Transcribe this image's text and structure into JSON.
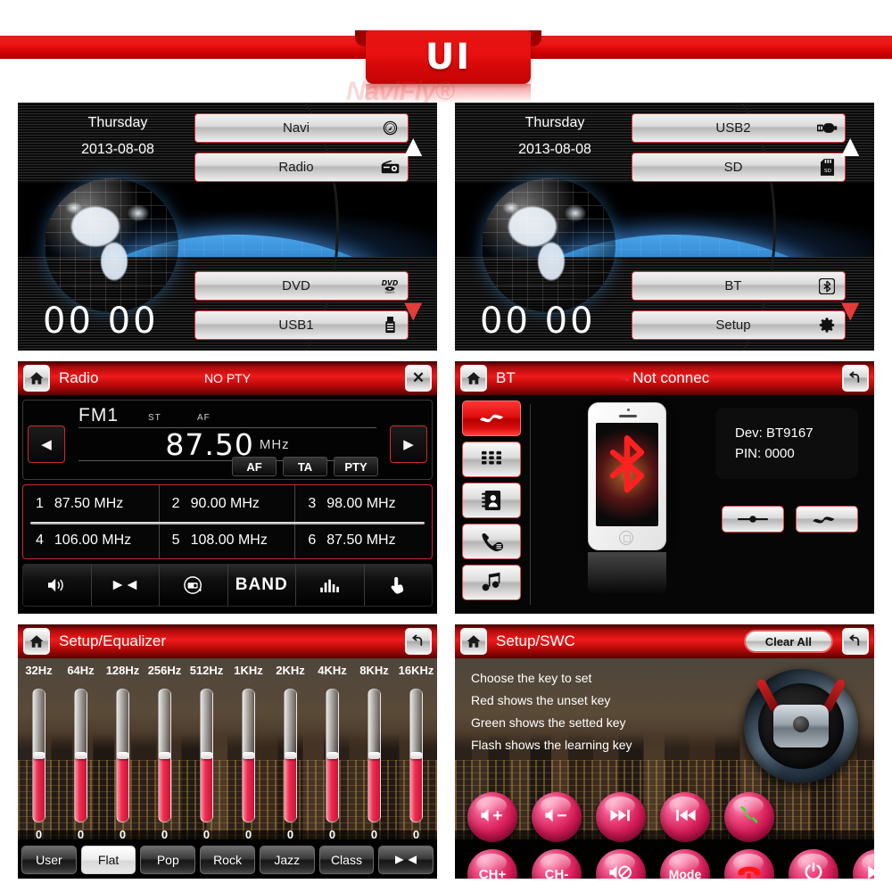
{
  "banner": {
    "title": "UI",
    "watermark": "NaviFly®"
  },
  "colors": {
    "accent_red": "#e01414",
    "panel_bg": "#000000",
    "button_silver": "#dcdcdc",
    "eq_fill": "#ef2d52",
    "swc_key": "#d41a55"
  },
  "home_left": {
    "day": "Thursday",
    "date": "2013-08-08",
    "clock": "00 00",
    "buttons": [
      {
        "label": "Navi",
        "icon": "compass-icon"
      },
      {
        "label": "Radio",
        "icon": "radio-icon"
      },
      {
        "label": "DVD",
        "icon": "dvd-video-icon"
      },
      {
        "label": "USB1",
        "icon": "usb-icon"
      }
    ],
    "page_up": "▲",
    "page_down": "▼"
  },
  "home_right": {
    "day": "Thursday",
    "date": "2013-08-08",
    "clock": "00 00",
    "buttons": [
      {
        "label": "USB2",
        "icon": "usb-stick-icon"
      },
      {
        "label": "SD",
        "icon": "sd-card-icon"
      },
      {
        "label": "BT",
        "icon": "bluetooth-icon"
      },
      {
        "label": "Setup",
        "icon": "gear-icon"
      }
    ],
    "page_up": "▲",
    "page_down": "▼"
  },
  "radio": {
    "title": "Radio",
    "pty_status": "NO PTY",
    "home_icon": "home-icon",
    "close_icon": "✕",
    "band": "FM1",
    "stereo_flag": "ST",
    "af_flag": "AF",
    "frequency": "87.50",
    "unit": "MHz",
    "prev_icon": "◀",
    "next_icon": "▶",
    "tags": [
      "AF",
      "TA",
      "PTY"
    ],
    "presets": [
      {
        "num": "1",
        "freq": "87.50 MHz"
      },
      {
        "num": "2",
        "freq": "90.00 MHz"
      },
      {
        "num": "3",
        "freq": "98.00 MHz"
      },
      {
        "num": "4",
        "freq": "106.00 MHz"
      },
      {
        "num": "5",
        "freq": "108.00 MHz"
      },
      {
        "num": "6",
        "freq": "87.50 MHz"
      }
    ],
    "tools": [
      {
        "name": "volume-icon",
        "glyph": "🔊"
      },
      {
        "name": "balance-icon",
        "glyph": "▶◀"
      },
      {
        "name": "autoscan-icon",
        "glyph": "⟳"
      },
      {
        "name": "band-label",
        "glyph": "BAND"
      },
      {
        "name": "equalizer-icon",
        "glyph": "ılıl"
      },
      {
        "name": "touch-icon",
        "glyph": "☚"
      }
    ]
  },
  "bt": {
    "title": "BT",
    "status": "Not connec",
    "home_icon": "home-icon",
    "back_icon": "↰",
    "side_buttons": [
      {
        "name": "bt-connect-icon",
        "glyph": "〰",
        "active": true
      },
      {
        "name": "bt-dialpad-icon",
        "glyph": "▦",
        "active": false
      },
      {
        "name": "bt-phonebook-icon",
        "glyph": "👤",
        "active": false
      },
      {
        "name": "bt-callog-icon",
        "glyph": "📞",
        "active": false
      },
      {
        "name": "bt-music-icon",
        "glyph": "♫",
        "active": false
      }
    ],
    "device_label": "Dev: BT9167",
    "pin_label": "PIN: 0000",
    "bluetooth_symbol": "ᚼ",
    "actions": [
      {
        "name": "bt-pair-button",
        "glyph": "—●—"
      },
      {
        "name": "bt-connect-button",
        "glyph": "〰"
      }
    ]
  },
  "equalizer": {
    "title": "Setup/Equalizer",
    "home_icon": "home-icon",
    "back_icon": "↰",
    "presets": [
      {
        "label": "User",
        "active": false
      },
      {
        "label": "Flat",
        "active": true
      },
      {
        "label": "Pop",
        "active": false
      },
      {
        "label": "Rock",
        "active": false
      },
      {
        "label": "Jazz",
        "active": false
      },
      {
        "label": "Class",
        "active": false
      }
    ],
    "balance_icon": "▶◀"
  },
  "chart_data": {
    "type": "bar",
    "title": "Setup/Equalizer",
    "categories": [
      "32Hz",
      "64Hz",
      "128Hz",
      "256Hz",
      "512Hz",
      "1KHz",
      "2KHz",
      "4KHz",
      "8KHz",
      "16KHz"
    ],
    "values": [
      0,
      0,
      0,
      0,
      0,
      0,
      0,
      0,
      0,
      0
    ],
    "value_labels": [
      "0",
      "0",
      "0",
      "0",
      "0",
      "0",
      "0",
      "0",
      "0",
      "0"
    ],
    "xlabel": "",
    "ylabel": "",
    "ylim": [
      -12,
      12
    ],
    "grid": false,
    "legend": "none",
    "orientation": "vertical-sliders"
  },
  "swc": {
    "title": "Setup/SWC",
    "home_icon": "home-icon",
    "back_icon": "↰",
    "clear_all": "Clear All",
    "instructions": [
      "Choose the key to set",
      "Red shows the unset key",
      "Green shows the setted key",
      "Flash shows the learning key"
    ],
    "wheel_icon": "steering-wheel-icon",
    "keys_row1": [
      {
        "name": "volume-up-key",
        "glyph": "🔊+",
        "label": ""
      },
      {
        "name": "volume-down-key",
        "glyph": "🔊−",
        "label": ""
      },
      {
        "name": "next-track-key",
        "glyph": "▶▶|",
        "label": ""
      },
      {
        "name": "prev-track-key",
        "glyph": "|◀◀",
        "label": ""
      },
      {
        "name": "answer-call-key",
        "glyph": "📞",
        "label": ""
      }
    ],
    "keys_row2": [
      {
        "name": "channel-up-key",
        "glyph": "",
        "label": "CH+"
      },
      {
        "name": "channel-down-key",
        "glyph": "",
        "label": "CH-"
      },
      {
        "name": "mute-key",
        "glyph": "🔇",
        "label": ""
      },
      {
        "name": "mode-key",
        "glyph": "",
        "label": "Mode"
      },
      {
        "name": "hangup-call-key",
        "glyph": "📞",
        "label": ""
      },
      {
        "name": "power-key",
        "glyph": "⏻",
        "label": ""
      },
      {
        "name": "play-pause-key",
        "glyph": "▶❚❚",
        "label": ""
      }
    ]
  }
}
